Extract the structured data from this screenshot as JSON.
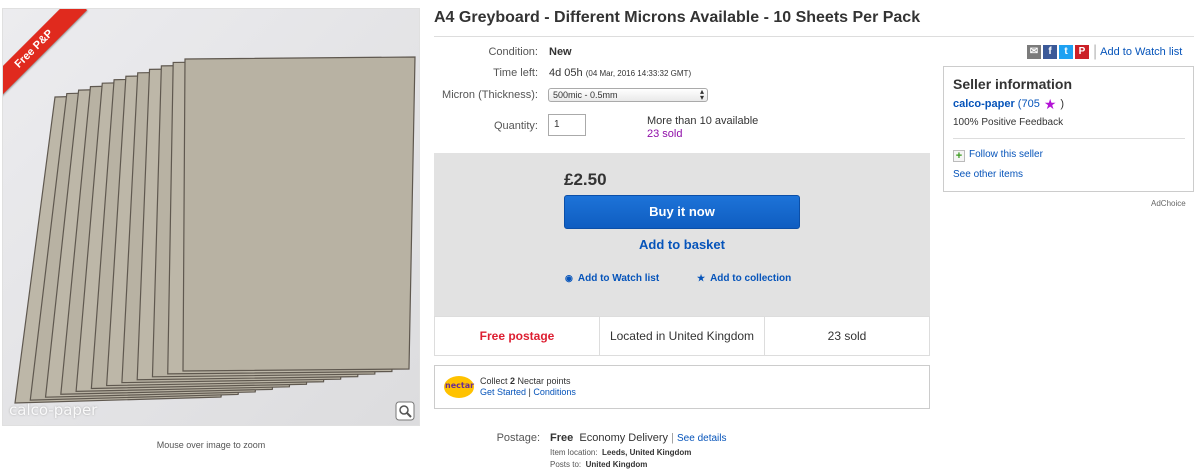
{
  "image": {
    "badge": "Free P&P",
    "watermark": "calco-paper",
    "zoom_hint": "Mouse over image to zoom"
  },
  "listing": {
    "title": "A4 Greyboard - Different Microns Available - 10 Sheets Per Pack",
    "condition_label": "Condition:",
    "condition_value": "New",
    "time_label": "Time left:",
    "time_value": "4d 05h",
    "time_detail": "(04 Mar, 2016   14:33:32 GMT)",
    "micron_label": "Micron (Thickness):",
    "micron_selected": "500mic - 0.5mm",
    "quantity_label": "Quantity:",
    "quantity_value": "1",
    "availability": "More than 10 available",
    "sold_count": "23 sold"
  },
  "purchase": {
    "price": "£2.50",
    "buy_now": "Buy it now",
    "add_to_basket": "Add to basket",
    "add_to_watch": "Add to Watch list",
    "add_to_collection": "Add to collection"
  },
  "summary": {
    "postage": "Free postage",
    "location": "Located in United Kingdom",
    "sold": "23 sold"
  },
  "nectar": {
    "logo": "nectar",
    "collect_prefix": "Collect ",
    "points": "2",
    "collect_suffix": " Nectar points",
    "get_started": "Get Started",
    "conditions": "Conditions",
    "divider": "|"
  },
  "postage": {
    "label": "Postage:",
    "free": "Free",
    "service": "Economy Delivery",
    "see_details": "See details",
    "divider": "|",
    "item_location_label": "Item location:",
    "item_location": "Leeds, United Kingdom",
    "posts_to_label": "Posts to:",
    "posts_to": "United Kingdom"
  },
  "share": {
    "watch": "Add to Watch list",
    "divider": "|",
    "icons": [
      "email-icon",
      "facebook-icon",
      "twitter-icon",
      "pinterest-icon"
    ],
    "colors": {
      "email": "#7b7b7b",
      "facebook": "#3b5998",
      "twitter": "#1da1f2",
      "pinterest": "#cb2027"
    }
  },
  "seller": {
    "heading": "Seller information",
    "name": "calco-paper",
    "score_open": " (",
    "score": "705",
    "score_close": ")",
    "feedback": "100% Positive Feedback",
    "follow": "Follow this seller",
    "see_other": "See other items"
  },
  "adchoice": "AdChoice",
  "colors": {
    "link": "#0654ba",
    "button": "#0f5dc1",
    "free_postage": "#dd1e31",
    "sold": "#8f0ea8",
    "badge": "#e02a1e"
  }
}
